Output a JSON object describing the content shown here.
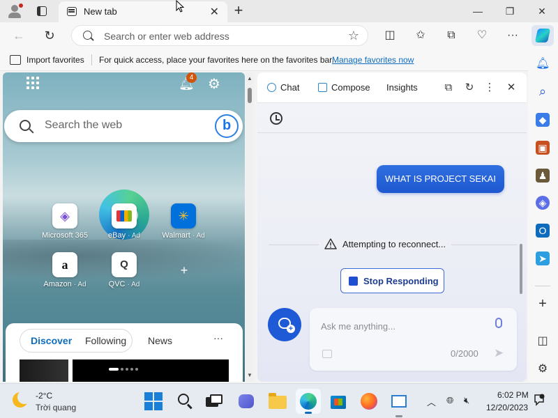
{
  "browser": {
    "tab": {
      "title": "New tab"
    },
    "address": {
      "placeholder": "Search or enter web address"
    },
    "favorites_bar": {
      "import_label": "Import favorites",
      "hint": "For quick access, place your favorites here on the favorites bar.",
      "manage_link": "Manage favorites now"
    }
  },
  "new_tab_page": {
    "notification_count": "4",
    "search_placeholder": "Search the web",
    "tiles": [
      {
        "label": "Microsoft 365",
        "ad": "",
        "icon": "microsoft-365-icon"
      },
      {
        "label": "eBay",
        "ad": "· Ad",
        "icon": "ebay-icon"
      },
      {
        "label": "Walmart",
        "ad": "· Ad",
        "icon": "walmart-icon"
      },
      {
        "label": "Amazon",
        "ad": "· Ad",
        "icon": "amazon-icon"
      },
      {
        "label": "QVC",
        "ad": "· Ad",
        "icon": "qvc-icon"
      }
    ],
    "feed_tabs": {
      "discover": "Discover",
      "following": "Following",
      "news": "News",
      "more": "···"
    }
  },
  "chat_pane": {
    "tabs": {
      "chat": "Chat",
      "compose": "Compose",
      "insights": "Insights"
    },
    "user_message": "WHAT IS PROJECT SEKAI",
    "status": "Attempting to reconnect...",
    "stop_button": "Stop Responding",
    "input_placeholder": "Ask me anything...",
    "char_count": "0/2000"
  },
  "taskbar": {
    "weather": {
      "temp": "-2°C",
      "condition": "Trời quang"
    },
    "clock": {
      "time": "6:02 PM",
      "date": "12/20/2023"
    }
  },
  "colors": {
    "accent": "#1f5ad6",
    "link": "#0f6cbd",
    "user_bubble": "#2f6fe0",
    "badge": "#d0540b"
  }
}
